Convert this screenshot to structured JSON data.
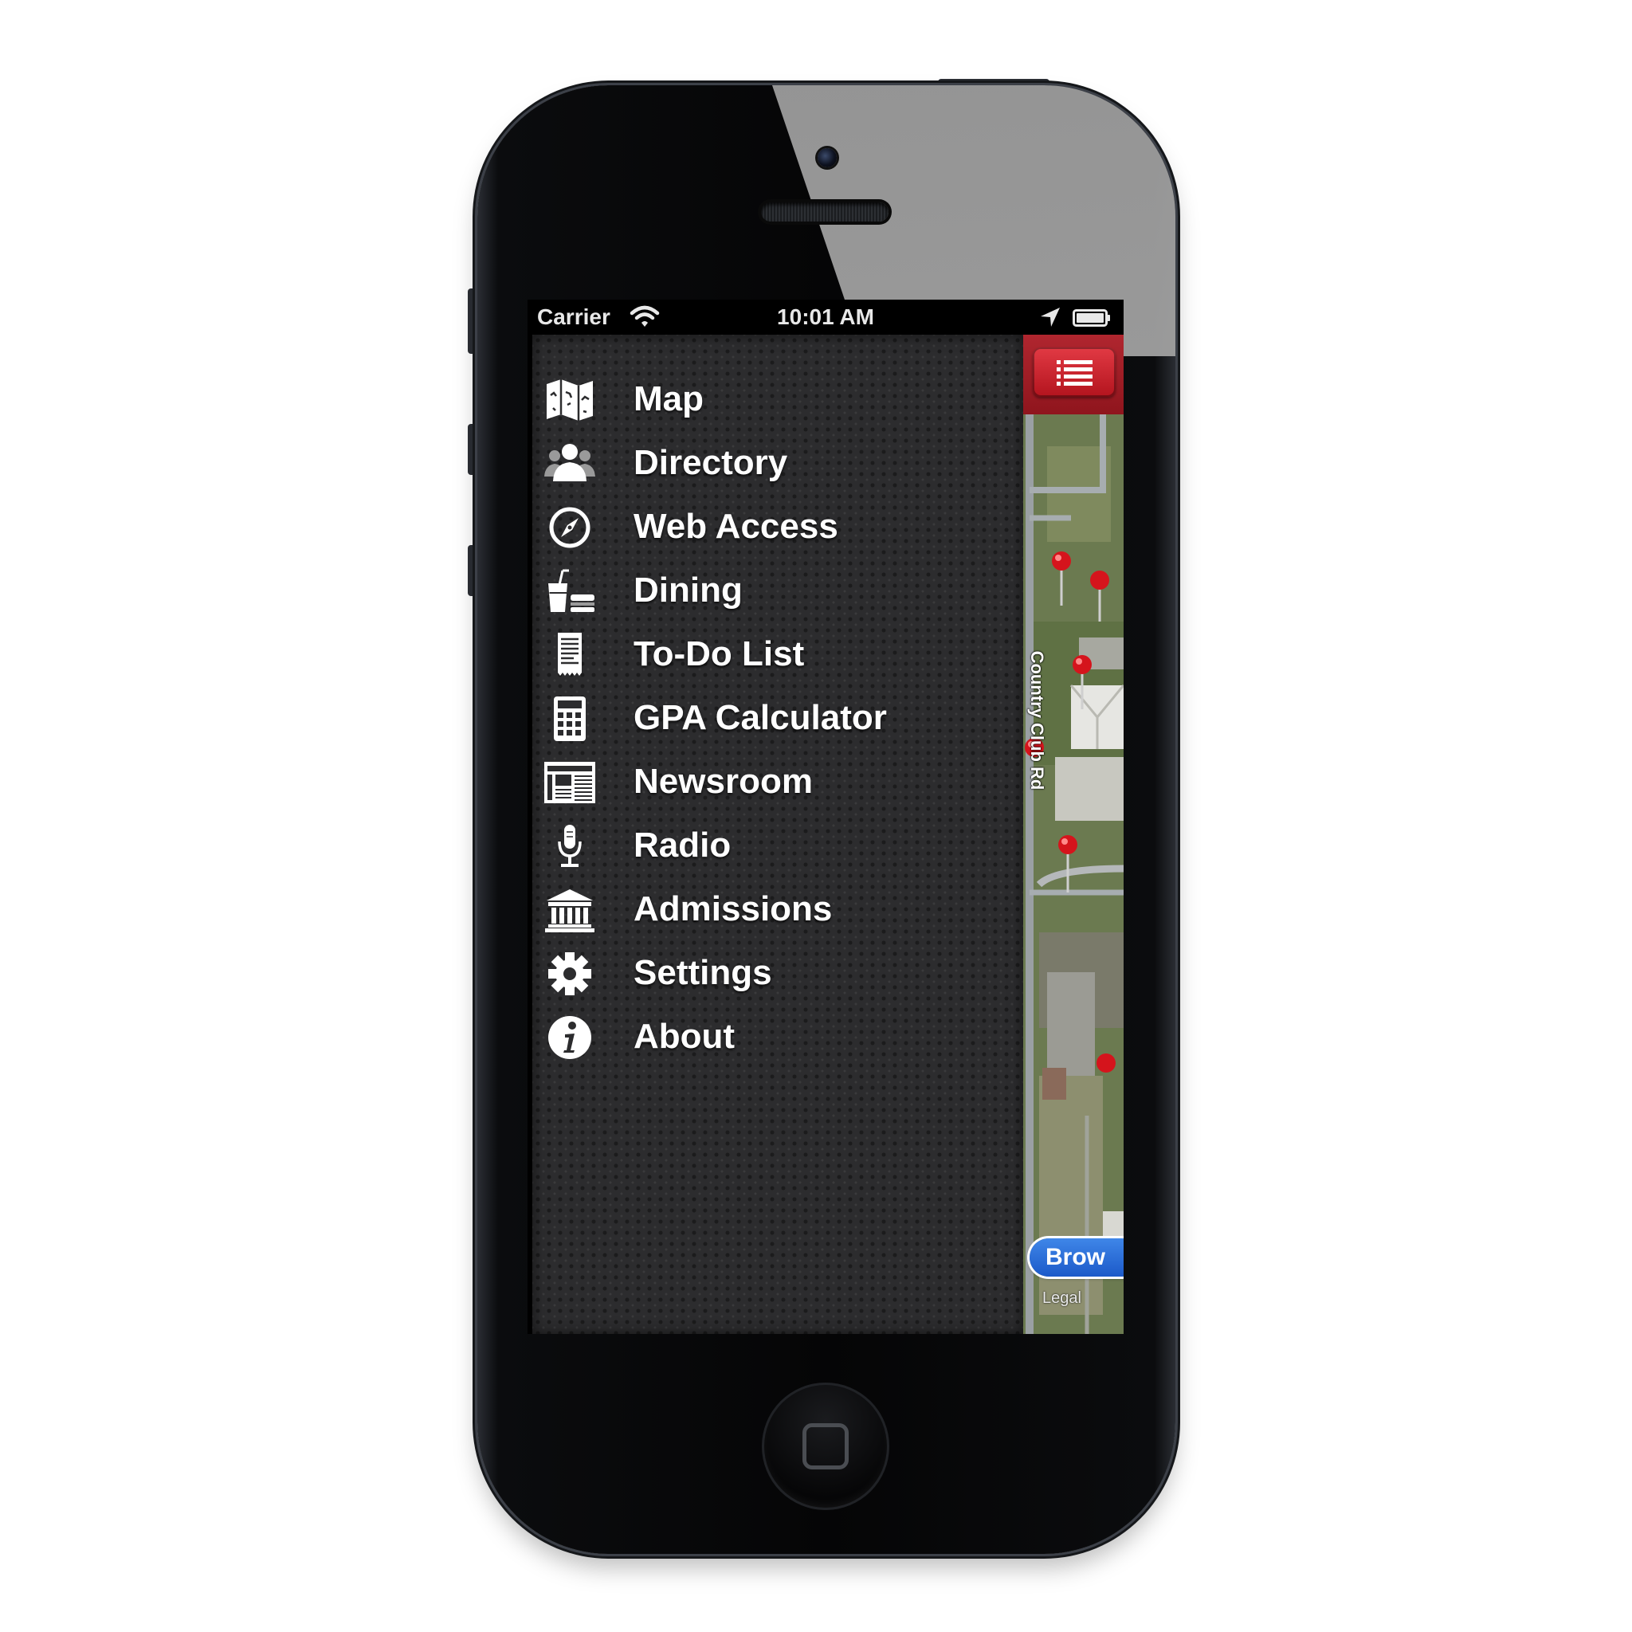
{
  "status_bar": {
    "carrier": "Carrier",
    "time": "10:01 AM",
    "icons": [
      "wifi-icon",
      "location-arrow-icon",
      "battery-icon"
    ]
  },
  "menu": {
    "items": [
      {
        "label": "Map",
        "icon": "map-icon"
      },
      {
        "label": "Directory",
        "icon": "people-icon"
      },
      {
        "label": "Web Access",
        "icon": "compass-icon"
      },
      {
        "label": "Dining",
        "icon": "drink-food-icon"
      },
      {
        "label": "To-Do List",
        "icon": "receipt-icon"
      },
      {
        "label": "GPA Calculator",
        "icon": "calculator-icon"
      },
      {
        "label": "Newsroom",
        "icon": "newspaper-icon"
      },
      {
        "label": "Radio",
        "icon": "microphone-icon"
      },
      {
        "label": "Admissions",
        "icon": "institution-icon"
      },
      {
        "label": "Settings",
        "icon": "gear-icon"
      },
      {
        "label": "About",
        "icon": "info-icon"
      }
    ]
  },
  "map": {
    "road_label": "Country Club Rd",
    "browse_label": "Brow",
    "legal_label": "Legal",
    "list_button_icon": "list-icon"
  },
  "colors": {
    "accent_red": "#b3141e",
    "menu_background": "#2c2c2e",
    "browse_blue": "#1c5ac9"
  }
}
